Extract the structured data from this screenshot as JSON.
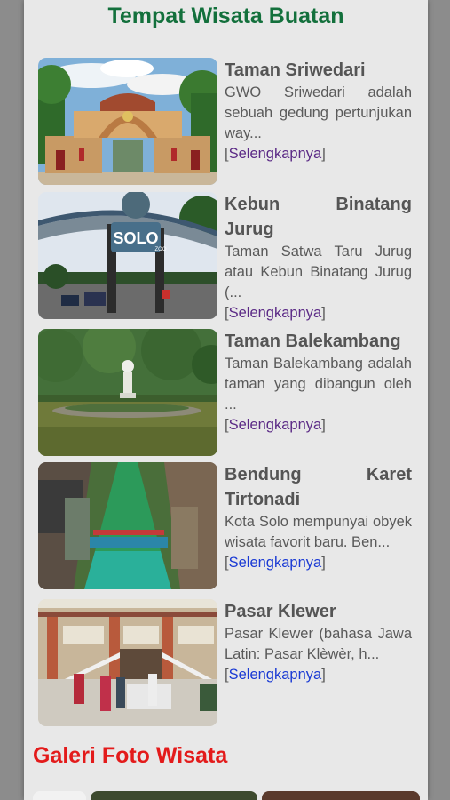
{
  "section": {
    "title": "Tempat Wisata Buatan"
  },
  "items": [
    {
      "title": "Taman Sriwedari",
      "desc": "GWO Sriwedari adalah sebuah gedung pertunjukan way...",
      "bracket_open": "[",
      "link": "Selengkapnya",
      "bracket_close": "]",
      "link_state": "visited"
    },
    {
      "title": "Kebun Binatang Jurug",
      "desc": "Taman Satwa Taru Jurug atau Kebun Binatang Jurug (...",
      "bracket_open": "[",
      "link": "Selengkapnya",
      "bracket_close": "]",
      "link_state": "visited"
    },
    {
      "title": "Taman Balekambang",
      "desc": "Taman Balekambang adalah taman yang dibangun oleh ...",
      "bracket_open": "[",
      "link": "Selengkapnya",
      "bracket_close": "]",
      "link_state": "visited"
    },
    {
      "title": "Bendung Karet Tirtonadi",
      "desc": "Kota Solo mempunyai obyek wisata favorit baru. Ben...",
      "bracket_open": "[",
      "link": "Selengkapnya",
      "bracket_close": "]",
      "link_state": "unvisited"
    },
    {
      "title": "Pasar Klewer",
      "desc": "Pasar Klewer (bahasa Jawa Latin: Pasar Klèwèr, h...",
      "bracket_open": "[",
      "link": "Selengkapnya",
      "bracket_close": "]",
      "link_state": "unvisited"
    }
  ],
  "zoo_sign": {
    "text": "SOLO",
    "subtext": "ZOO"
  },
  "gallery": {
    "title": "Galeri Foto Wisata"
  },
  "colors": {
    "section_title": "#13703c",
    "gallery_title": "#e31b1b",
    "link_visited": "#5b2a86",
    "link_unvisited": "#1a3ad4"
  }
}
